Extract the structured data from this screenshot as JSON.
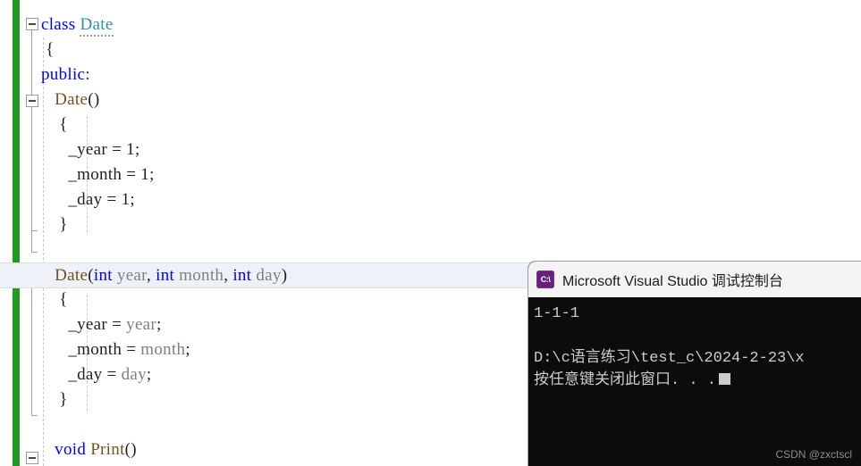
{
  "editor": {
    "name": "visual-studio-code-editor",
    "language": "cpp",
    "change_bar_color": "#1f9b1f",
    "current_line_index": 8,
    "lines": [
      {
        "indent": 0,
        "tokens": [
          {
            "t": "class ",
            "c": "kw"
          },
          {
            "t": "Date",
            "c": "type-user squiggle"
          }
        ]
      },
      {
        "indent": 1,
        "tokens": [
          {
            "t": "{",
            "c": "punc"
          }
        ]
      },
      {
        "indent": 0,
        "tokens": [
          {
            "t": "public",
            "c": "kw"
          },
          {
            "t": ":",
            "c": "punc"
          }
        ]
      },
      {
        "indent": 3,
        "tokens": [
          {
            "t": "Date",
            "c": "func"
          },
          {
            "t": "()",
            "c": "punc"
          }
        ]
      },
      {
        "indent": 4,
        "tokens": [
          {
            "t": "{",
            "c": "punc"
          }
        ]
      },
      {
        "indent": 6,
        "tokens": [
          {
            "t": "_year",
            "c": "ident"
          },
          {
            "t": " = ",
            "c": "punc"
          },
          {
            "t": "1",
            "c": "num"
          },
          {
            "t": ";",
            "c": "punc"
          }
        ]
      },
      {
        "indent": 6,
        "tokens": [
          {
            "t": "_month",
            "c": "ident"
          },
          {
            "t": " = ",
            "c": "punc"
          },
          {
            "t": "1",
            "c": "num"
          },
          {
            "t": ";",
            "c": "punc"
          }
        ]
      },
      {
        "indent": 6,
        "tokens": [
          {
            "t": "_day",
            "c": "ident"
          },
          {
            "t": " = ",
            "c": "punc"
          },
          {
            "t": "1",
            "c": "num"
          },
          {
            "t": ";",
            "c": "punc"
          }
        ]
      },
      {
        "indent": 4,
        "tokens": [
          {
            "t": "}",
            "c": "punc"
          }
        ]
      },
      {
        "indent": 0,
        "tokens": []
      },
      {
        "indent": 3,
        "tokens": [
          {
            "t": "Date",
            "c": "func"
          },
          {
            "t": "(",
            "c": "punc"
          },
          {
            "t": "int",
            "c": "kw"
          },
          {
            "t": " year",
            "c": "param"
          },
          {
            "t": ", ",
            "c": "punc"
          },
          {
            "t": "int",
            "c": "kw"
          },
          {
            "t": " month",
            "c": "param"
          },
          {
            "t": ", ",
            "c": "punc"
          },
          {
            "t": "int",
            "c": "kw"
          },
          {
            "t": " day",
            "c": "param"
          },
          {
            "t": ")",
            "c": "punc"
          }
        ]
      },
      {
        "indent": 4,
        "tokens": [
          {
            "t": "{",
            "c": "punc"
          }
        ]
      },
      {
        "indent": 6,
        "tokens": [
          {
            "t": "_year",
            "c": "ident"
          },
          {
            "t": " = ",
            "c": "punc"
          },
          {
            "t": "year",
            "c": "param"
          },
          {
            "t": ";",
            "c": "punc"
          }
        ]
      },
      {
        "indent": 6,
        "tokens": [
          {
            "t": "_month",
            "c": "ident"
          },
          {
            "t": " = ",
            "c": "punc"
          },
          {
            "t": "month",
            "c": "param"
          },
          {
            "t": ";",
            "c": "punc"
          }
        ]
      },
      {
        "indent": 6,
        "tokens": [
          {
            "t": "_day",
            "c": "ident"
          },
          {
            "t": " = ",
            "c": "punc"
          },
          {
            "t": "day",
            "c": "param"
          },
          {
            "t": ";",
            "c": "punc"
          }
        ]
      },
      {
        "indent": 4,
        "tokens": [
          {
            "t": "}",
            "c": "punc"
          }
        ]
      },
      {
        "indent": 0,
        "tokens": []
      },
      {
        "indent": 3,
        "tokens": [
          {
            "t": "void",
            "c": "kw"
          },
          {
            "t": " Print",
            "c": "func"
          },
          {
            "t": "()",
            "c": "punc"
          }
        ]
      }
    ],
    "fold_markers": [
      {
        "line": 0,
        "collapsed": false
      },
      {
        "line": 3,
        "collapsed": false
      },
      {
        "line": 10,
        "collapsed": false
      },
      {
        "line": 17,
        "collapsed": false
      }
    ]
  },
  "console": {
    "title": "Microsoft Visual Studio 调试控制台",
    "icon": "console-cmd-icon",
    "icon_label": "C:\\",
    "titlebar_color": "#f3f3f3",
    "background_color": "#0c0c0c",
    "text_color": "#cccccc",
    "output": [
      "1-1-1",
      "",
      "D:\\c语言练习\\test_c\\2024-2-23\\x",
      "按任意键关闭此窗口. . ."
    ]
  },
  "watermark": {
    "text": "CSDN @zxctscl"
  }
}
